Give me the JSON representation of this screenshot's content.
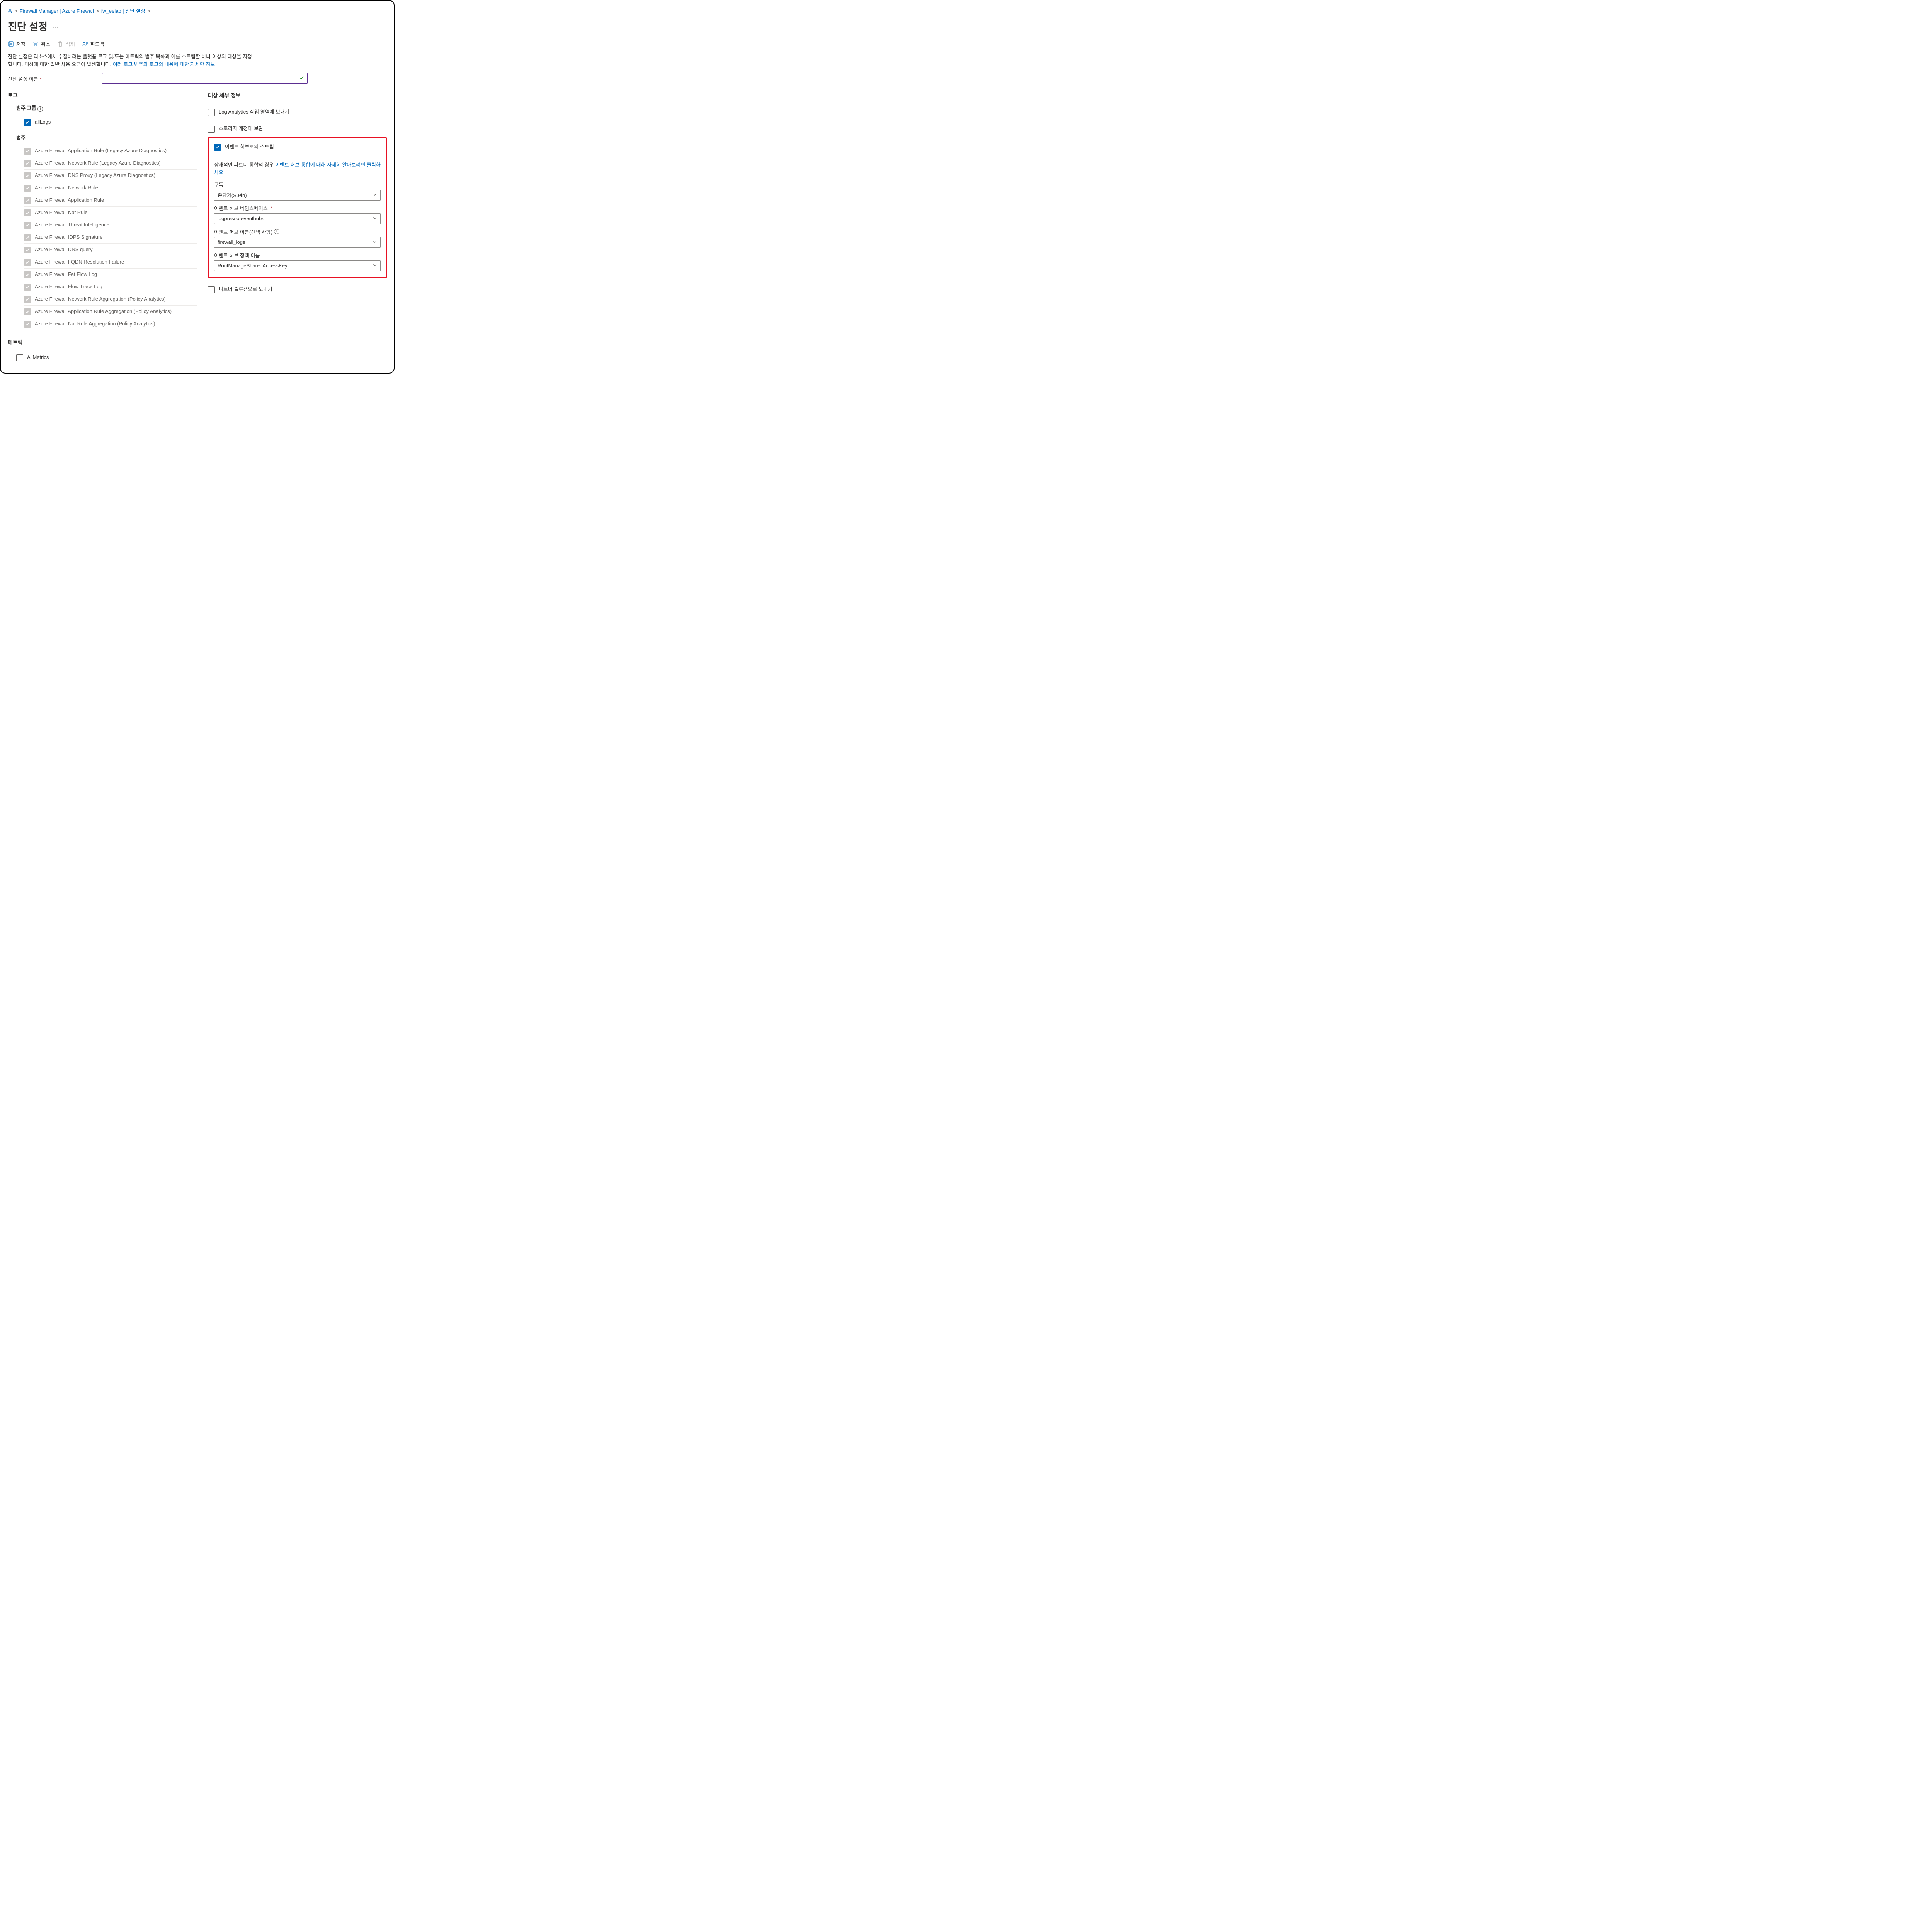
{
  "breadcrumb": {
    "home": "홈",
    "item1": "Firewall Manager | Azure Firewall",
    "item2": "fw_eelab | 진단 설정"
  },
  "page_title": "진단 설정",
  "toolbar": {
    "save": "저장",
    "discard": "취소",
    "delete": "삭제",
    "feedback": "피드백"
  },
  "description": {
    "line1a": "진단 설정은 리소스에서 수집하려는 플랫폼 로그 및/또는 메트릭의 범주 목록과 이를 스트림할 하나 이상의 대상을 지정",
    "line1b": "합니다. 대상에 대한 일반 사용 요금이 발생합니다. ",
    "learn_more_link": "여러 로그 범주와 로그의 내용에 대한 자세한 정보"
  },
  "name_label": "진단 설정 이름",
  "left": {
    "logs_header": "로그",
    "category_group_header": "범주 그룹",
    "all_logs": "allLogs",
    "category_header": "범주",
    "categories": [
      "Azure Firewall Application Rule (Legacy Azure Diagnostics)",
      "Azure Firewall Network Rule (Legacy Azure Diagnostics)",
      "Azure Firewall DNS Proxy (Legacy Azure Diagnostics)",
      "Azure Firewall Network Rule",
      "Azure Firewall Application Rule",
      "Azure Firewall Nat Rule",
      "Azure Firewall Threat Intelligence",
      "Azure Firewall IDPS Signature",
      "Azure Firewall DNS query",
      "Azure Firewall FQDN Resolution Failure",
      "Azure Firewall Fat Flow Log",
      "Azure Firewall Flow Trace Log",
      "Azure Firewall Network Rule Aggregation (Policy Analytics)",
      "Azure Firewall Application Rule Aggregation (Policy Analytics)",
      "Azure Firewall Nat Rule Aggregation (Policy Analytics)"
    ],
    "metrics_header": "메트릭",
    "all_metrics": "AllMetrics"
  },
  "right": {
    "header": "대상 세부 정보",
    "dest": {
      "law": "Log Analytics 작업 영역에 보내기",
      "storage": "스토리지 계정에 보관",
      "eventhub": "이벤트 허브로의 스트림",
      "partner": "파트너 솔루션으로 보내기"
    },
    "eh_note_a": "잠재적인 파트너 통합의 경우 ",
    "eh_note_link": "이벤트 허브 통합에 대해 자세히 알아보려면 클릭하세요.",
    "fields": {
      "sub_label": "구독",
      "sub_value": "종량제(S.Pin)",
      "ns_label": "이벤트 허브 네임스페이스",
      "ns_value": "logpresso-eventhubs",
      "ehname_label": "이벤트 허브 이름(선택 사항)",
      "ehname_value": "firewall_logs",
      "policy_label": "이벤트 허브 정책 이름",
      "policy_value": "RootManageSharedAccessKey"
    }
  }
}
